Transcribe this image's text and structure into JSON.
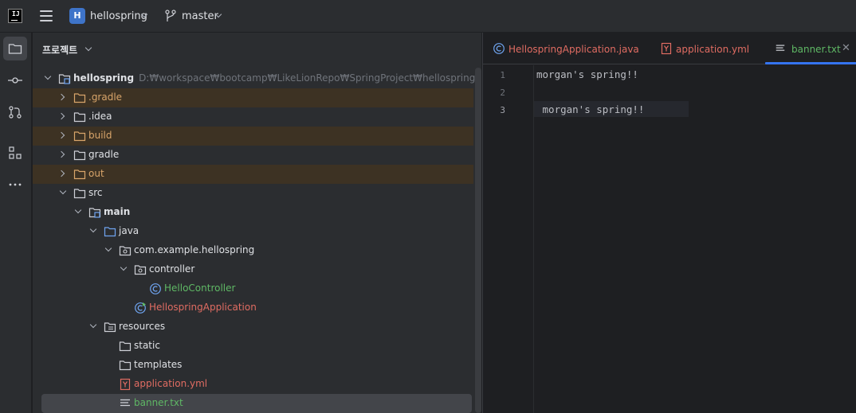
{
  "titlebar": {
    "project_badge": "H",
    "project_name": "hellospring",
    "branch": "master"
  },
  "panel": {
    "title": "프로젝트"
  },
  "tree": [
    {
      "label": "hellospring",
      "hint": "D:₩workspace₩bootcamp₩LikeLionRepo₩SpringProject₩hellospring"
    },
    {
      "label": ".gradle"
    },
    {
      "label": ".idea"
    },
    {
      "label": "build"
    },
    {
      "label": "gradle"
    },
    {
      "label": "out"
    },
    {
      "label": "src"
    },
    {
      "label": "main"
    },
    {
      "label": "java"
    },
    {
      "label": "com.example.hellospring"
    },
    {
      "label": "controller"
    },
    {
      "label": "HelloController"
    },
    {
      "label": "HellospringApplication"
    },
    {
      "label": "resources"
    },
    {
      "label": "static"
    },
    {
      "label": "templates"
    },
    {
      "label": "application.yml"
    },
    {
      "label": "banner.txt"
    }
  ],
  "tabs": [
    {
      "label": "HellospringApplication.java"
    },
    {
      "label": "application.yml"
    },
    {
      "label": "banner.txt"
    }
  ],
  "editor": {
    "line_numbers": [
      "1",
      "2",
      "3"
    ],
    "lines": [
      "morgan's spring!!",
      "",
      " morgan's spring!!"
    ]
  },
  "colors": {
    "accent": "#3574f0",
    "excluded_folder": "#d9a56a",
    "modified_file": "#5fb865",
    "error_file": "#e06c62"
  }
}
